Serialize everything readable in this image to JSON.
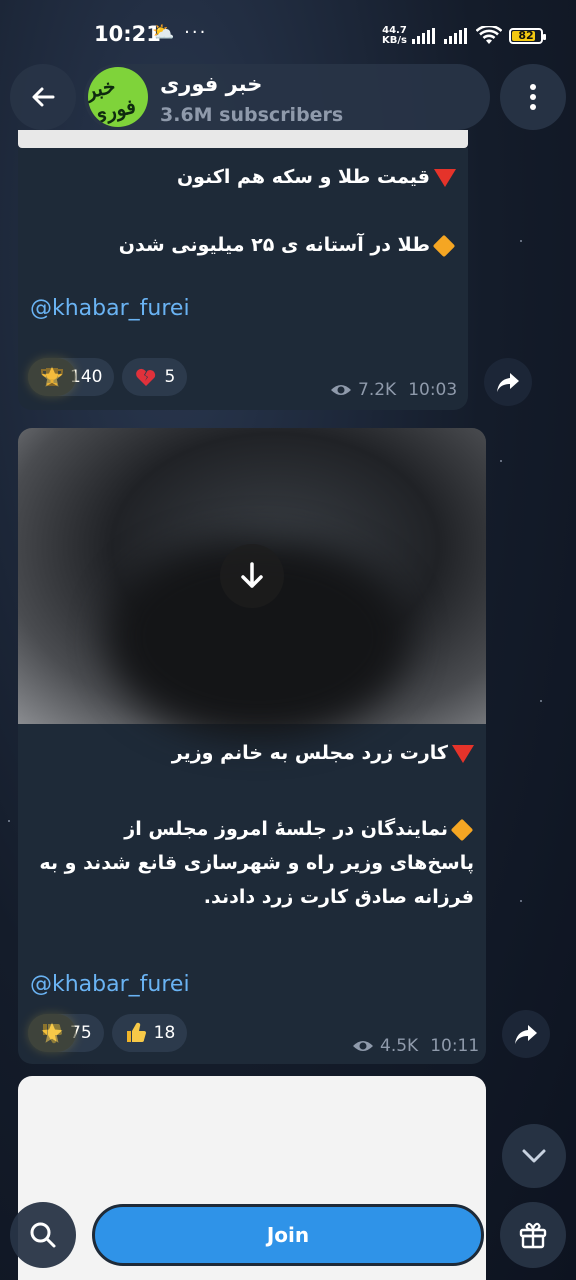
{
  "status_bar": {
    "time": "10:21",
    "left_icons": "⛅ ···",
    "speed_value": "44.7",
    "speed_unit": "KB/s",
    "battery_percent": 82
  },
  "header": {
    "channel_title": "خبر فوری",
    "subscribers": "3.6M subscribers",
    "avatar_text": "خبر فوری"
  },
  "messages": [
    {
      "headline": "قیمت طلا و سکه هم اکنون",
      "body": "طلا در آستانه ی ۲۵ میلیونی شدن",
      "link": "@khabar_furei",
      "reactions": [
        {
          "icon": "star",
          "count": ""
        },
        {
          "icon": "trophy",
          "count": "140"
        },
        {
          "icon": "broken-heart",
          "count": "5"
        }
      ],
      "views": "7.2K",
      "time": "10:03"
    },
    {
      "headline": "کارت زرد مجلس به خانم وزیر",
      "body": "نمایندگان در جلسهٔ امروز مجلس از پاسخ‌های وزیر راه و شهرسازی قانع شدند و به فرزانه صادق کارت زرد دادند.",
      "link": "@khabar_furei",
      "reactions": [
        {
          "icon": "star",
          "count": ""
        },
        {
          "icon": "thumbs-down",
          "count": "75"
        },
        {
          "icon": "thumbs-up",
          "count": "18"
        }
      ],
      "views": "4.5K",
      "time": "10:11"
    }
  ],
  "bottom": {
    "join_label": "Join"
  },
  "colors": {
    "accent": "#2f93e8",
    "link": "#6ab3f3",
    "bubble": "#1e2a38",
    "battery": "#f2c811"
  }
}
